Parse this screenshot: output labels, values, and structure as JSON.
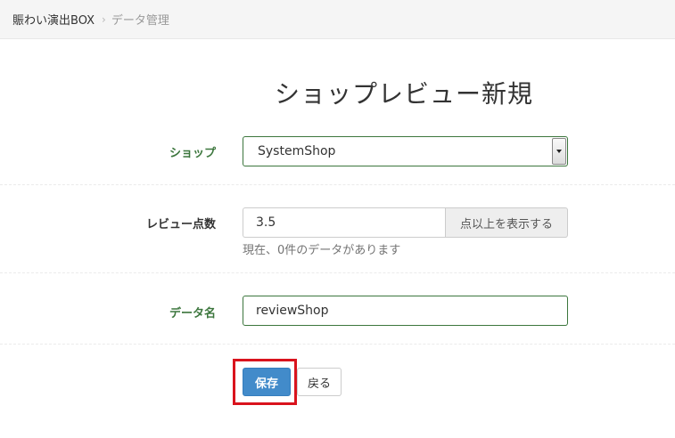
{
  "breadcrumb": {
    "home": "賑わい演出BOX",
    "separator": "›",
    "current": "データ管理"
  },
  "page": {
    "title": "ショップレビュー新規"
  },
  "form": {
    "shop": {
      "label": "ショップ",
      "selected": "SystemShop"
    },
    "review_score": {
      "label": "レビュー点数",
      "value": "3.5",
      "addon": "点以上を表示する",
      "help": "現在、0件のデータがあります"
    },
    "data_name": {
      "label": "データ名",
      "value": "reviewShop"
    },
    "buttons": {
      "save": "保存",
      "back": "戻る"
    }
  },
  "colors": {
    "label_success": "#3c763d",
    "primary": "#428bca",
    "highlight": "#d9131d"
  }
}
